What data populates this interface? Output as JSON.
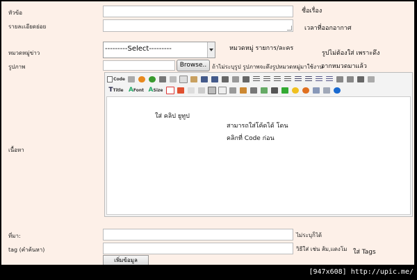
{
  "form": {
    "title_label": "หัวข้อ",
    "detail_label": "รายละเอียดย่อย",
    "category_label": "หมวดหมู่ข่าว",
    "image_label": "รูปภาพ",
    "content_label": "เนื้อหา",
    "source_label": "ที่มา:",
    "tag_label": "tag (คำค้นหา)",
    "select_value": "---------Select---------",
    "browse_label": "Browse..",
    "image_hint": "ถ้าไม่ระบุรูป รูปภาพจะดึงรูปหมวดหมู่มาใช้งาน",
    "source_hint": "ไม่ระบุก็ได้",
    "tag_hint": "วิธีใส่ เช่น ส้ม,แดงโม",
    "submit_label": "เพิ่มข้อมูล"
  },
  "notes": {
    "title_note": "ชื่อเรื่อง",
    "detail_note": "เวลาที่ออกอากาศ",
    "category_note": "หมวดหมู่   รายการ/ละคร",
    "image_note_1": "รูปไม่ต้องใส่   เพราะดึง",
    "image_note_2": "จากหมวดมาแล้ว",
    "editor_note_1": "ใส่   คลิป   ยูทูป",
    "editor_note_2": "สามารถใส่โค้ดได้    โดน",
    "editor_note_3": "คลิกที่   Code ก่อน",
    "tag_note": "ใส่   Tags"
  },
  "toolbar": {
    "code_label": "Code",
    "title_label": "Title",
    "font_label": "Font",
    "size_label": "Size"
  },
  "footer": "[947x608] http://upic.me/"
}
